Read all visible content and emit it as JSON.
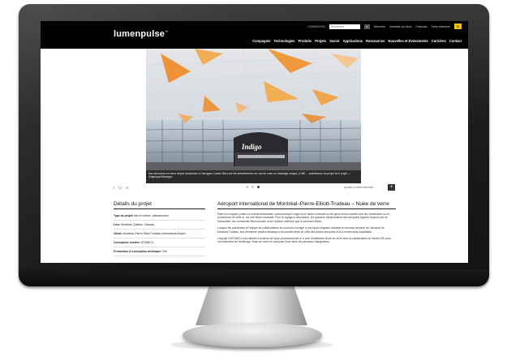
{
  "brand": {
    "logo_text": "lumenpulse",
    "logo_mark": "™"
  },
  "utility": {
    "login": "CONNEXION",
    "search_placeholder": "Recherche",
    "links": [
      "Mémoire",
      "Investiss du Nord",
      "Français",
      "Votre sélection"
    ],
    "cart_count": "0"
  },
  "nav": [
    "Compagnie",
    "Technologies",
    "Produits",
    "Projets",
    "Savoir",
    "Applications",
    "Ressources",
    "Nouvelles et Événements",
    "Carrières",
    "Contact"
  ],
  "hero": {
    "caption": "Des structures en verre dépoli translucide à l'aérogare Lumen Bleu ont été sélectionnées en vue de créer un éclairage unique, à 360 ... architecture du projet et le projet — Graphique Beaugon"
  },
  "share": {
    "icons": [
      "facebook-icon",
      "twitter-icon",
      "linkedin-icon"
    ]
  },
  "carousel": {
    "count": 3,
    "active": 3
  },
  "selection": {
    "add_label": "Ajouter à votre sélection",
    "plus": "+"
  },
  "details": {
    "title": "Détails du projet",
    "rows": [
      {
        "label": "Type de projet:",
        "value": "Arts et culture, Infrastructure"
      },
      {
        "label": "Lieu:",
        "value": "Montréal, Québec, Canada"
      },
      {
        "label": "Client:",
        "value": "Montréal–Pierre Elliott Trudeau International Airport"
      },
      {
        "label": "Concepteur lumière:",
        "value": "ATOMIC3"
      },
      {
        "label": "Production et conception technique:",
        "value": "20K"
      }
    ]
  },
  "article": {
    "title": "Aéroport international de Montréal–Pierre-Elliott-Trudeau – Nuée de verre",
    "paragraphs": [
      "Faire d'un espace public un endroit mémorable, surtout lorsqu'il s'agit d'une station d'escale où les gens font la navette vers leur destination ou en provenance de celle-ci, est une tâche colossale. Pour le voyageur accoutumé, les spacieux débarcadères des aéroports figurent toujours par se ressembler, leur immensité étant souvent d'une froideur uniforme que la mémoire efface.",
      "Lorsque les architectes et l'équipe de collaborateurs se sont mis à songer à une façon originale d'animer le nouveau terminal de l'aéroport de Montréal-Trudeau, leur démarche visait à démarquer la nouvelle jetée de celle des autres aéroports et à la rendre ainsi inoubliable.",
      "L'équipe d'ATOMIC3 s'est attelée à la tâche de façon professionnelle et a créé l'installation Nuée de verre avec la collaboration du Studio 20K pour l'orchestration de l'éclairage. Nuée de verre se compose d'une série de panneaux triangulaires"
    ]
  },
  "colors": {
    "topbar": "#000000",
    "cart": "#f2c300",
    "bezel": "#1d1d1d"
  }
}
